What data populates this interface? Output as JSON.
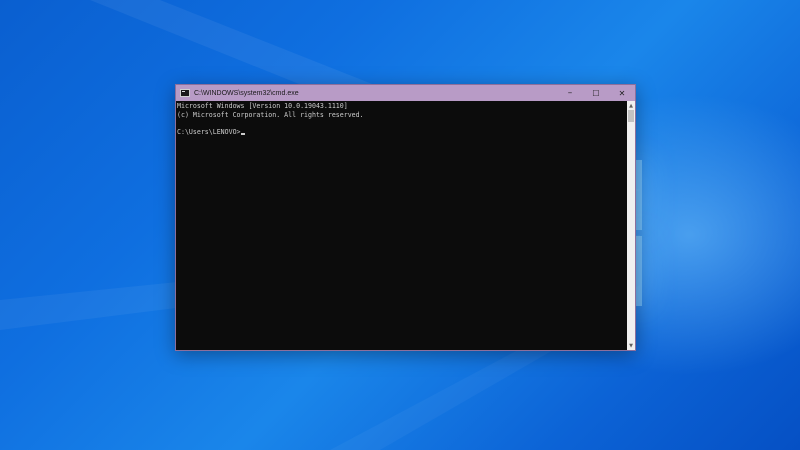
{
  "window": {
    "title": "C:\\WINDOWS\\system32\\cmd.exe",
    "app_icon": "cmd-icon",
    "controls": {
      "minimize": "–",
      "maximize": "☐",
      "close": "✕"
    }
  },
  "console": {
    "lines": [
      "Microsoft Windows [Version 10.0.19043.1110]",
      "(c) Microsoft Corporation. All rights reserved.",
      "",
      "C:\\Users\\LENOVO>"
    ]
  },
  "scrollbar": {
    "up_arrow": "▲",
    "down_arrow": "▼"
  },
  "colors": {
    "titlebar": "#b89bc6",
    "console_bg": "#0c0c0c",
    "console_fg": "#cccccc",
    "desktop": "#0f6fe0"
  }
}
